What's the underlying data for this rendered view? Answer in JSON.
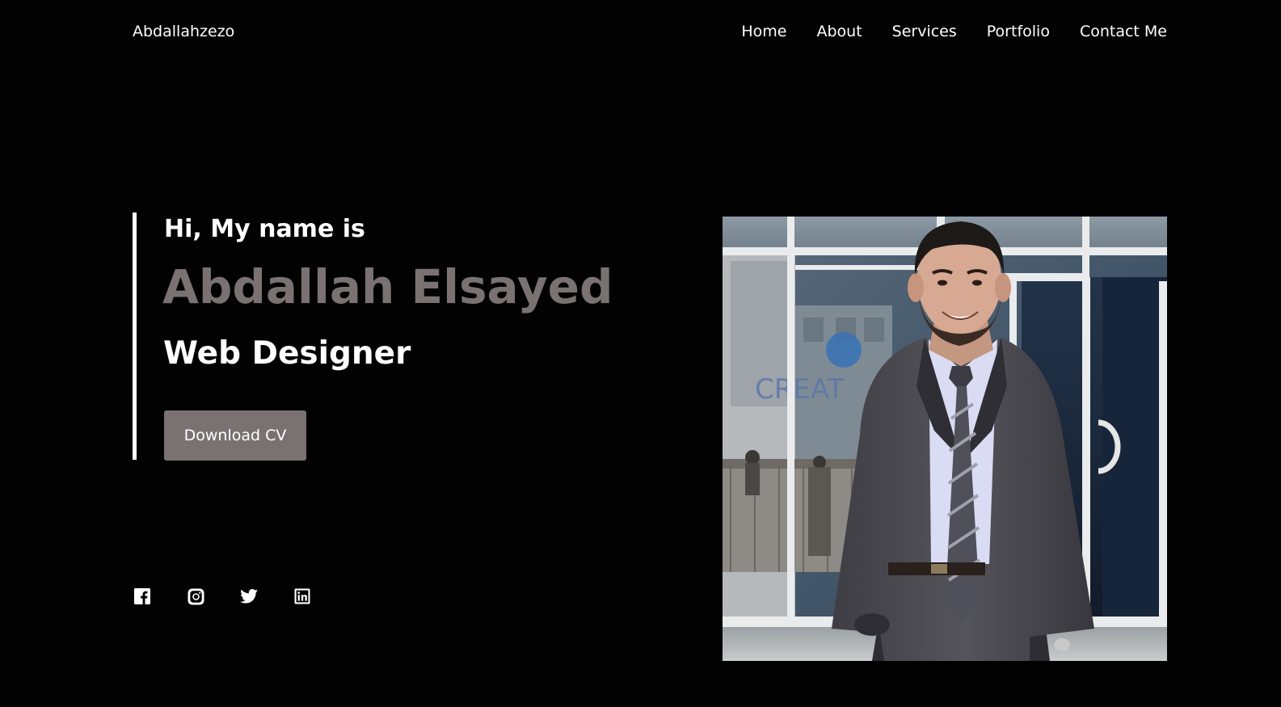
{
  "header": {
    "logo": "Abdallahzezo",
    "nav": [
      {
        "label": "Home"
      },
      {
        "label": "About"
      },
      {
        "label": "Services"
      },
      {
        "label": "Portfolio"
      },
      {
        "label": "Contact Me"
      }
    ]
  },
  "hero": {
    "greeting": "Hi, My name is",
    "name": "Abdallah Elsayed",
    "role": "Web Designer",
    "cv_button": "Download CV",
    "name_color": "#7a7172",
    "button_color": "#7a7172"
  },
  "socials": [
    {
      "icon": "facebook-icon"
    },
    {
      "icon": "instagram-icon"
    },
    {
      "icon": "twitter-icon"
    },
    {
      "icon": "linkedin-icon"
    }
  ],
  "photo": {
    "backdrop_text": "CREAT"
  }
}
